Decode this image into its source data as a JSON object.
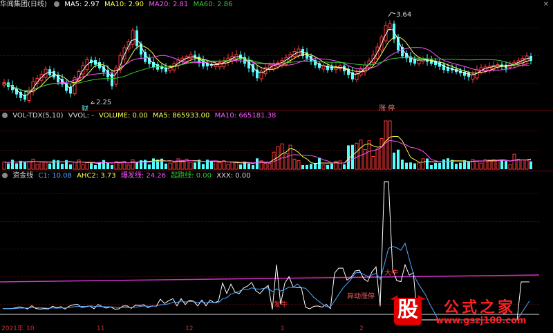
{
  "panel1": {
    "title": "华闻集团(日线)",
    "ma5": "MA5: 2.97",
    "ma10": "MA10: 2.90",
    "ma20": "MA20: 2.81",
    "ma60": "MA60: 2.86",
    "high_label": "3.64",
    "low_label": "2.25",
    "tag_cai": "财",
    "tag_zhangting": "涨 停"
  },
  "panel2": {
    "title": "VOL-TDX(5,10)",
    "vvol": "VVOL: -",
    "volume": "VOLUME: 0.00",
    "ma5": "MA5: 865933.00",
    "ma10": "MA10: 665181.38"
  },
  "panel3": {
    "title": "资金线",
    "c1": "C1: 10.08",
    "ahc2": "AHC2: 3.73",
    "baofa": "爆发线: 24.26",
    "qipao": "起跑线: 0.00",
    "xxx": "XXX: 0.00",
    "label_faniu": "发牛",
    "label_yidong": "异动涨停",
    "label_top": "大牛"
  },
  "dates": {
    "d1": "2021年",
    "d2": "10",
    "d3": "11",
    "d4": "12",
    "d5": "1",
    "d6": "2"
  },
  "watermark": {
    "logo_char": "股",
    "name": "公式之家",
    "url": "www.gszj100.com"
  },
  "colors": {
    "up": "#ff3c3c",
    "down": "#54ffff",
    "ma5": "#ffffff",
    "ma10": "#ffff55",
    "ma20": "#ff55ff",
    "ma60": "#33cc33",
    "grid": "#7a0b0b"
  }
}
